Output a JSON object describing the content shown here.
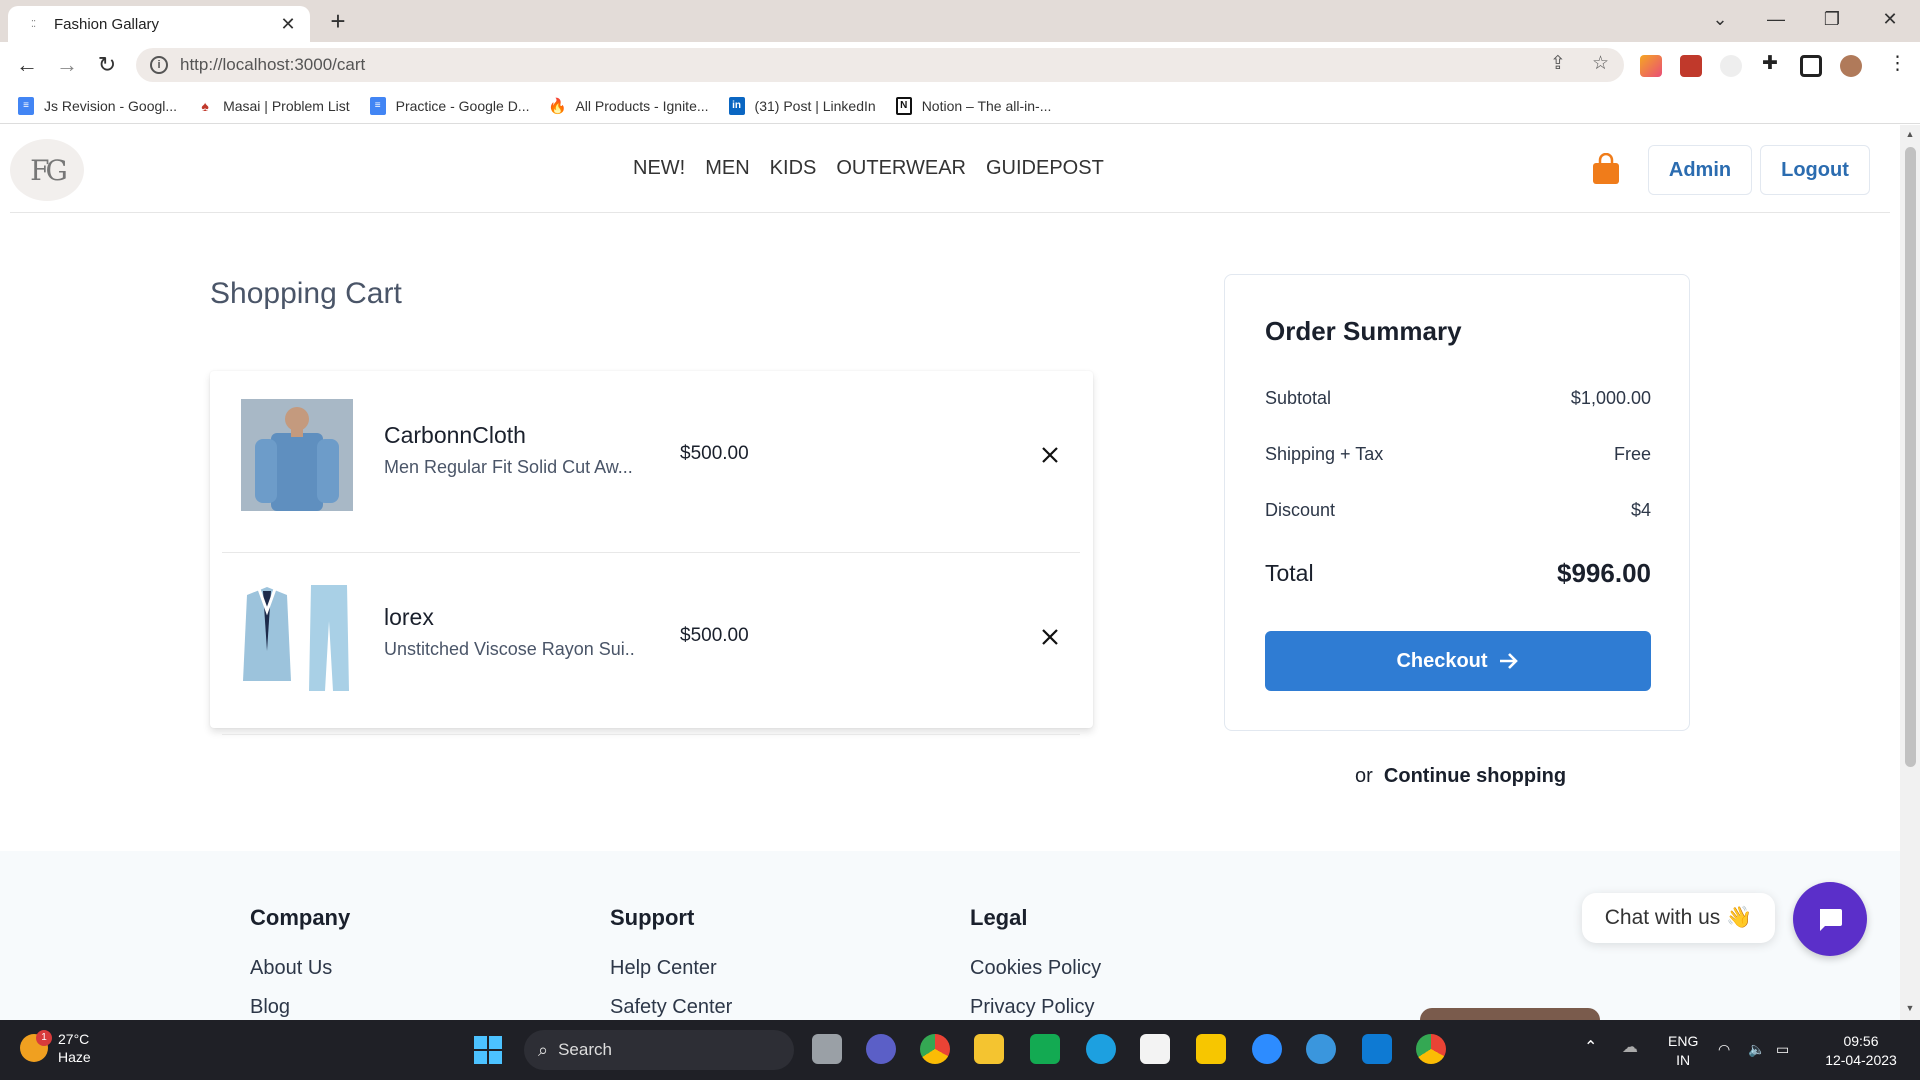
{
  "browser": {
    "tab_title": "Fashion Gallary",
    "url": "http://localhost:3000/cart",
    "bookmarks": [
      {
        "label": "Js Revision - Googl...",
        "icon": "google-docs-icon",
        "color": "#4285f4"
      },
      {
        "label": "Masai | Problem List",
        "icon": "masai-icon",
        "color": "#c0392b"
      },
      {
        "label": "Practice - Google D...",
        "icon": "google-docs-icon",
        "color": "#4285f4"
      },
      {
        "label": "All Products - Ignite...",
        "icon": "flame-icon",
        "color": "#f26522"
      },
      {
        "label": "(31) Post | LinkedIn",
        "icon": "linkedin-icon",
        "color": "#0a66c2"
      },
      {
        "label": "Notion – The all-in-...",
        "icon": "notion-icon",
        "color": "#111111"
      }
    ]
  },
  "header": {
    "logo_text": "FG",
    "nav": [
      "NEW!",
      "MEN",
      "KIDS",
      "OUTERWEAR",
      "GUIDEPOST"
    ],
    "admin_label": "Admin",
    "logout_label": "Logout",
    "accent_color": "#2b6cb0"
  },
  "cart": {
    "title": "Shopping Cart",
    "items": [
      {
        "name": "CarbonnCloth",
        "description": "Men Regular Fit Solid Cut Aw...",
        "price": "$500.00",
        "image": "denim-shirt-photo"
      },
      {
        "name": "lorex",
        "description": "Unstitched Viscose Rayon Sui...",
        "price": "$500.00",
        "image": "suit-photo"
      }
    ]
  },
  "summary": {
    "title": "Order Summary",
    "rows": [
      {
        "label": "Subtotal",
        "value": "$1,000.00"
      },
      {
        "label": "Shipping + Tax",
        "value": "Free"
      },
      {
        "label": "Discount",
        "value": "$4"
      }
    ],
    "total_label": "Total",
    "total_value": "$996.00",
    "checkout_label": "Checkout",
    "continue_prefix": "or",
    "continue_label": "Continue shopping",
    "checkout_color": "#2f7cd3"
  },
  "footer": {
    "columns": [
      {
        "title": "Company",
        "links": [
          "About Us",
          "Blog"
        ]
      },
      {
        "title": "Support",
        "links": [
          "Help Center",
          "Safety Center"
        ]
      },
      {
        "title": "Legal",
        "links": [
          "Cookies Policy",
          "Privacy Policy"
        ]
      }
    ],
    "chat_label": "Chat with us 👋"
  },
  "taskbar": {
    "weather_badge": "1",
    "temperature": "27°C",
    "weather": "Haze",
    "search_label": "Search",
    "language_top": "ENG",
    "language_bottom": "IN",
    "time": "09:56",
    "date": "12-04-2023"
  }
}
